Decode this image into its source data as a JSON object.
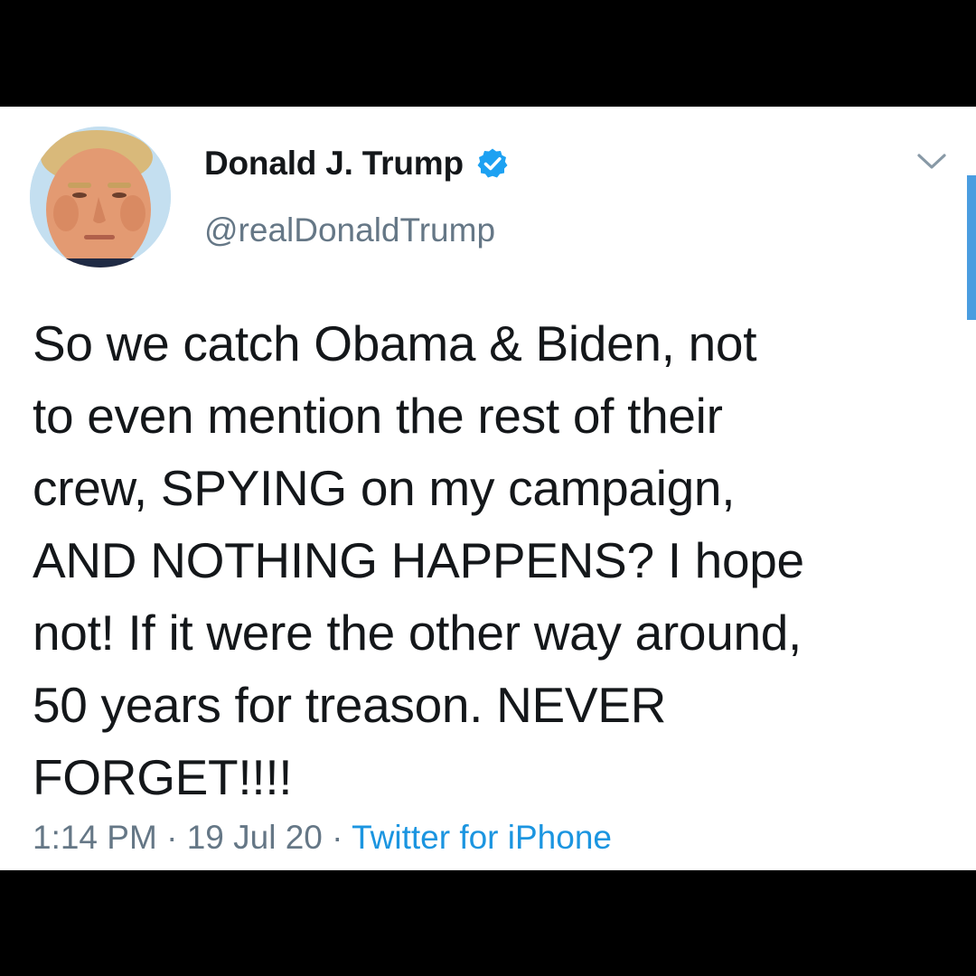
{
  "tweet": {
    "display_name": "Donald J. Trump",
    "handle": "@realDonaldTrump",
    "verified": true,
    "text_lines": [
      "So we catch Obama & Biden, not",
      "to even mention the rest of their",
      "crew, SPYING on my campaign,",
      "AND NOTHING HAPPENS? I hope",
      "not! If it were the other way around,",
      "50 years for treason. NEVER",
      "FORGET!!!!"
    ],
    "time": "1:14 PM",
    "separator": " · ",
    "date": "19 Jul 20",
    "source": "Twitter for iPhone"
  },
  "icons": {
    "verified": "verified-badge-icon",
    "menu": "chevron-down-icon"
  },
  "colors": {
    "background_frame": "#000000",
    "card": "#ffffff",
    "text_primary": "#14171a",
    "text_secondary": "#657786",
    "link": "#1b95e0",
    "verified_badge": "#1da1f2"
  }
}
